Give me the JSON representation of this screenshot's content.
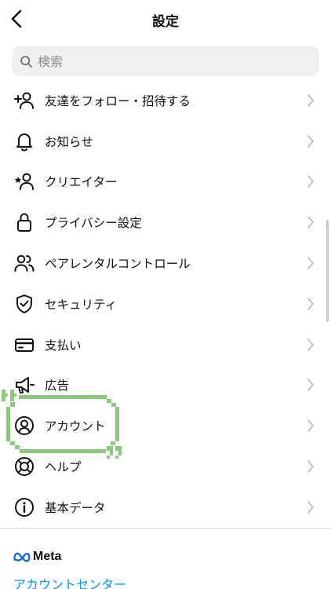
{
  "header": {
    "title": "設定"
  },
  "search": {
    "placeholder": "検索"
  },
  "menu": [
    {
      "id": "follow-invite",
      "label": "友達をフォロー・招待する",
      "icon": "add-person-icon"
    },
    {
      "id": "notifications",
      "label": "お知らせ",
      "icon": "bell-icon"
    },
    {
      "id": "creator",
      "label": "クリエイター",
      "icon": "star-person-icon"
    },
    {
      "id": "privacy",
      "label": "プライバシー設定",
      "icon": "lock-icon"
    },
    {
      "id": "parental",
      "label": "ペアレンタルコントロール",
      "icon": "people-icon"
    },
    {
      "id": "security",
      "label": "セキュリティ",
      "icon": "shield-check-icon"
    },
    {
      "id": "payments",
      "label": "支払い",
      "icon": "card-icon"
    },
    {
      "id": "ads",
      "label": "広告",
      "icon": "megaphone-icon"
    },
    {
      "id": "account",
      "label": "アカウント",
      "icon": "person-circle-icon"
    },
    {
      "id": "help",
      "label": "ヘルプ",
      "icon": "lifebuoy-icon"
    },
    {
      "id": "about",
      "label": "基本データ",
      "icon": "info-icon"
    }
  ],
  "footer": {
    "brand": "Meta",
    "account_center": "アカウントセンター"
  },
  "colors": {
    "link": "#0095f6",
    "highlight": "#8cc97f",
    "search_bg": "#efefef"
  }
}
